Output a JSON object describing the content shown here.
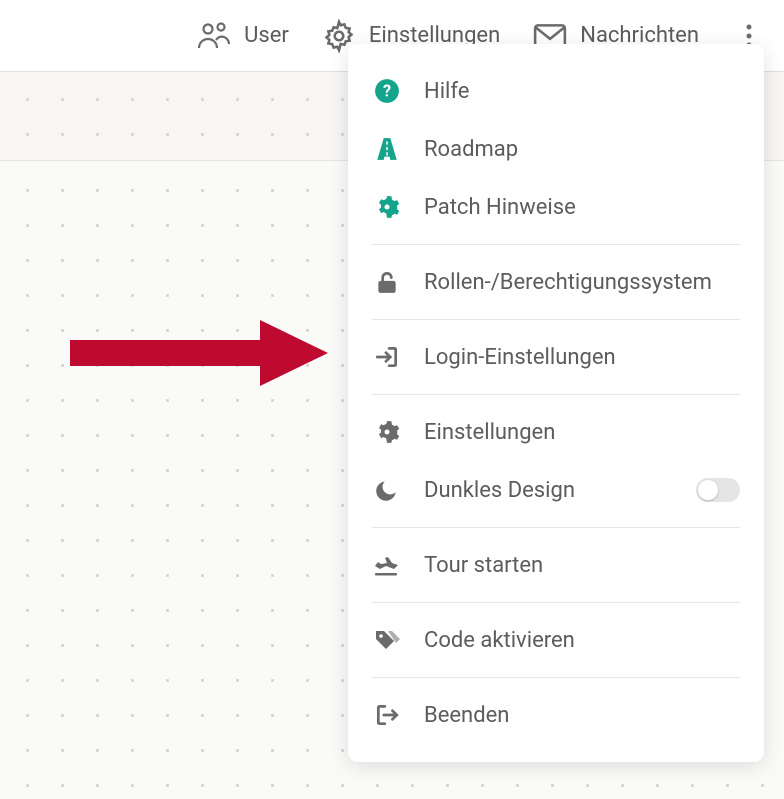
{
  "topbar": {
    "user_label": "User",
    "settings_label": "Einstellungen",
    "messages_label": "Nachrichten"
  },
  "menu": {
    "help": "Hilfe",
    "roadmap": "Roadmap",
    "patch_notes": "Patch Hinweise",
    "roles": "Rollen-/Berechtigungssystem",
    "login_settings": "Login-Einstellungen",
    "settings": "Einstellungen",
    "dark_mode": "Dunkles Design",
    "dark_mode_on": false,
    "start_tour": "Tour starten",
    "activate_code": "Code aktivieren",
    "exit": "Beenden"
  },
  "annotation": {
    "arrow_color": "#bf0a30"
  }
}
